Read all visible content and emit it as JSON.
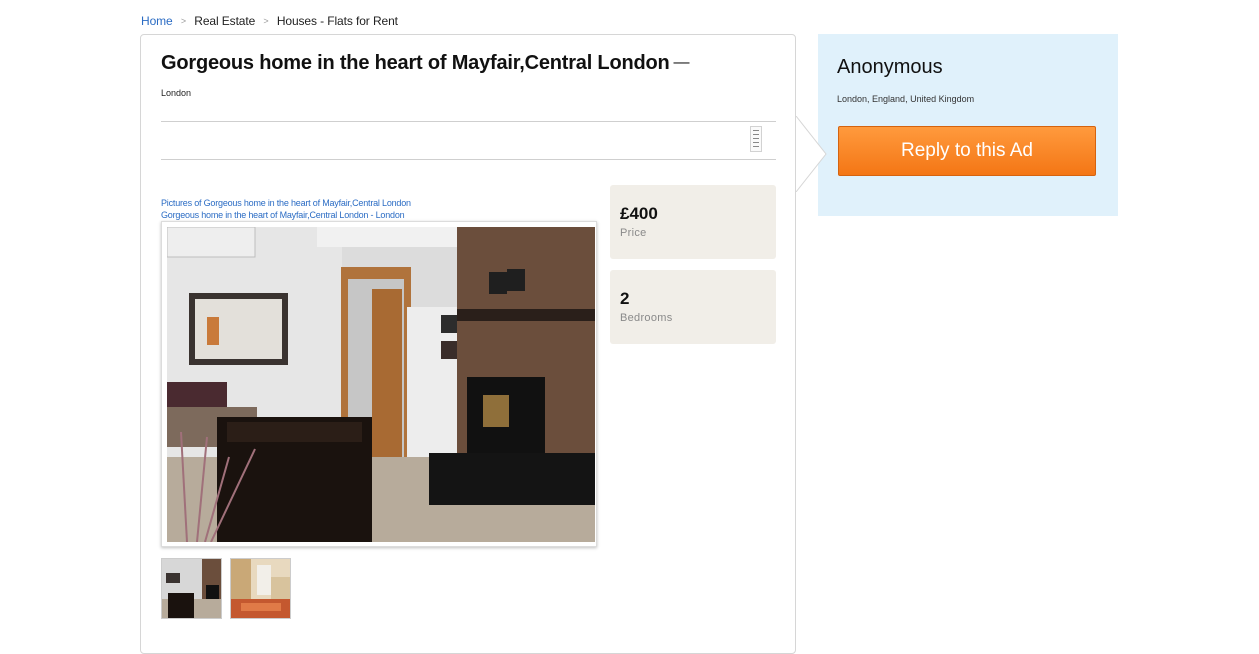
{
  "breadcrumb": {
    "home": "Home",
    "category": "Real Estate",
    "subcategory": "Houses - Flats for Rent",
    "separator": ">"
  },
  "listing": {
    "title": "Gorgeous home in the heart of Mayfair,Central London",
    "title_suffix": "—",
    "location": "London",
    "picture_caption_1": "Pictures of Gorgeous home in the heart of Mayfair,Central London",
    "picture_caption_2": "Gorgeous home in the heart of Mayfair,Central London - London"
  },
  "stats": {
    "price_value": "£400",
    "price_label": "Price",
    "bedrooms_value": "2",
    "bedrooms_label": "Bedrooms"
  },
  "seller": {
    "name": "Anonymous",
    "location": "London, England, United Kingdom",
    "reply_label": "Reply to this Ad"
  },
  "colors": {
    "link": "#2b6cc4",
    "seller_panel": "#e0f1fb",
    "reply_button": "#f47615",
    "stat_box": "#f1eee8"
  }
}
